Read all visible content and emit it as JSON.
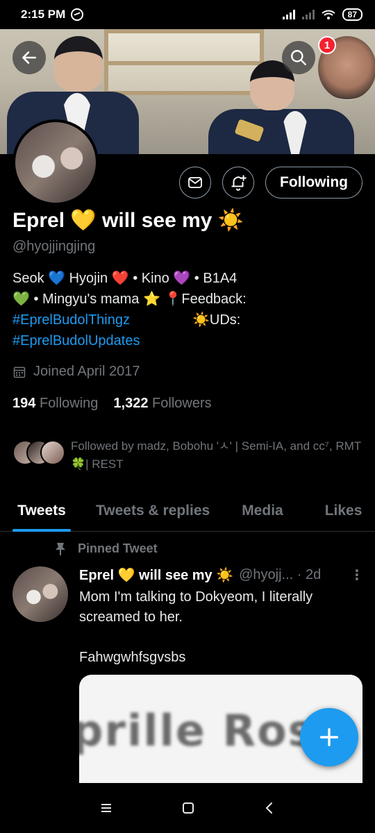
{
  "status": {
    "time": "2:15 PM",
    "battery": "87"
  },
  "notifications": {
    "count": "1"
  },
  "profile": {
    "name": "Eprel 💛 will see my ☀️",
    "handle": "@hyojjingjing",
    "bio_line1": "Seok 💙 Hyojin ❤️ • Kino 💜 • B1A4",
    "bio_line2": "💚 • Mingyu's mama ⭐ 📍Feedback:",
    "bio_link1": "#EprelBudolThingz",
    "bio_uds": "☀️UDs:",
    "bio_link2": "#EprelBudolUpdates",
    "joined": "Joined April 2017",
    "following_count": "194",
    "following_label": "Following",
    "followers_count": "1,322",
    "followers_label": "Followers",
    "followed_by": "Followed by madz, Bobohu 'ㅅ' | Semi-IA, and cc⁷, RMT 🍀| REST"
  },
  "actions": {
    "following_button": "Following"
  },
  "tabs": [
    {
      "label": "Tweets",
      "active": true
    },
    {
      "label": "Tweets & replies",
      "active": false
    },
    {
      "label": "Media",
      "active": false
    },
    {
      "label": "Likes",
      "active": false
    }
  ],
  "tweet": {
    "pinned_label": "Pinned Tweet",
    "author": "Eprel 💛 will see my ☀️",
    "handle_time": "@hyojj... · 2d",
    "text": "Mom I'm talking to Dokyeom, I literally screamed to her.\n\nFahwgwhfsgvsbs",
    "media_text": "prille Rose"
  },
  "colors": {
    "accent": "#1d9bf0",
    "muted": "#71767b",
    "badge": "#f4212e"
  }
}
